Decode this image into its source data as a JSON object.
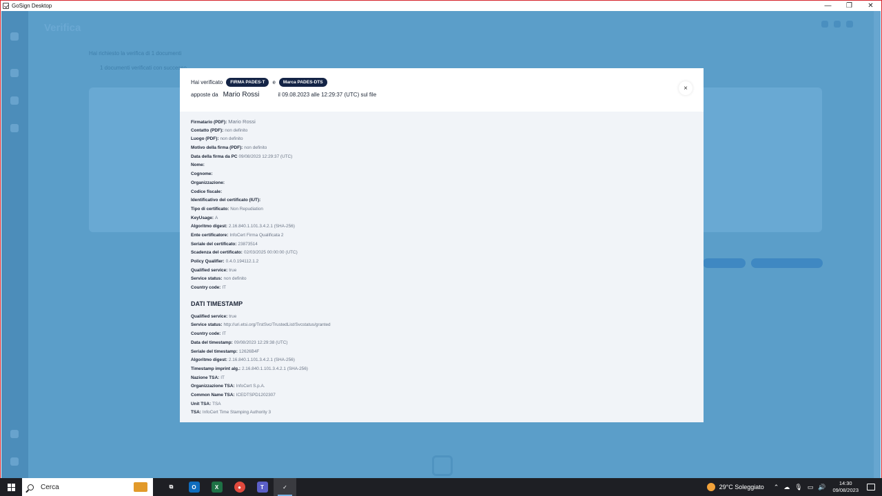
{
  "window": {
    "title": "GoSign Desktop",
    "controls": [
      "—",
      "❐",
      "✕"
    ]
  },
  "background_app": {
    "page_title": "Verifica",
    "line1": "Hai richiesto la verifica di 1 documenti",
    "line2": "1 documenti verificati con successo"
  },
  "modal": {
    "verified_prefix": "Hai verificato",
    "badge_signature": "FIRMA PADES-T",
    "conjunction": "e",
    "badge_timestamp": "Marca PADES-DTS",
    "applied_by": "apposte da",
    "signer_name": "Mario Rossi",
    "when": "il 09.08.2023 alle 12:29:37 (UTC) sul file",
    "close_symbol": "×",
    "signature_fields": [
      {
        "key": "Firmatario (PDF):",
        "value": "Mario Rossi"
      },
      {
        "key": "Contatto (PDF):",
        "value": "non definito"
      },
      {
        "key": "Luogo (PDF):",
        "value": "non definito"
      },
      {
        "key": "Motivo della firma (PDF):",
        "value": "non definito"
      },
      {
        "key": "Data della firma da PC",
        "value": "09/08/2023 12:29:37 (UTC)"
      },
      {
        "key": "Nome:",
        "value": ""
      },
      {
        "key": "Cognome:",
        "value": ""
      },
      {
        "key": "Organizzazione:",
        "value": ""
      },
      {
        "key": "Codice fiscale:",
        "value": ""
      },
      {
        "key": "Identificativo del certificato (IUT):",
        "value": ""
      },
      {
        "key": "Tipo di certificato:",
        "value": "Non Repudiation"
      },
      {
        "key": "KeyUsage:",
        "value": "A"
      },
      {
        "key": "Algoritmo digest:",
        "value": "2.16.840.1.101.3.4.2.1 (SHA-256)"
      },
      {
        "key": "Ente certificatore:",
        "value": "InfoCert Firma Qualificata 2"
      },
      {
        "key": "Seriale del certificato:",
        "value": "23873514"
      },
      {
        "key": "Scadenza del certificato:",
        "value": "02/03/2025 00:00:00 (UTC)"
      },
      {
        "key": "Policy Qualifier:",
        "value": "0.4.0.194112.1.2"
      },
      {
        "key": "Qualified service:",
        "value": "true"
      },
      {
        "key": "Service status:",
        "value": "non definito"
      },
      {
        "key": "Country code:",
        "value": "IT"
      }
    ],
    "timestamp_section_title": "DATI TIMESTAMP",
    "timestamp_fields": [
      {
        "key": "Qualified service:",
        "value": "true"
      },
      {
        "key": "Service status:",
        "value": "http://uri.etsi.org/TrstSvc/TrustedList/Svcstatus/granted"
      },
      {
        "key": "Country code:",
        "value": "IT"
      },
      {
        "key": "Data del timestamp:",
        "value": "09/08/2023 12:29:38 (UTC)"
      },
      {
        "key": "Seriale del timestamp:",
        "value": "12626B4F"
      },
      {
        "key": "Algoritmo digest:",
        "value": "2.16.840.1.101.3.4.2.1 (SHA-256)"
      },
      {
        "key": "Timestamp imprint alg.:",
        "value": "2.16.840.1.101.3.4.2.1 (SHA-256)"
      },
      {
        "key": "Nazione TSA:",
        "value": "IT"
      },
      {
        "key": "Organizzazione TSA:",
        "value": "InfoCert S.p.A."
      },
      {
        "key": "Common Name TSA:",
        "value": "ICEDTSPD1202307"
      },
      {
        "key": "Unit TSA:",
        "value": "TSA"
      },
      {
        "key": "TSA:",
        "value": "InfoCert Time Stamping Authority 3"
      }
    ]
  },
  "taskbar": {
    "search_placeholder": "Cerca",
    "weather": "29°C  Soleggiato",
    "time": "14:30",
    "date": "09/08/2023",
    "pinned": [
      {
        "name": "task-view-icon",
        "glyph": "⧉",
        "color": "#1e1f24"
      },
      {
        "name": "outlook-icon",
        "glyph": "O",
        "color": "#0f6cbd"
      },
      {
        "name": "excel-icon",
        "glyph": "X",
        "color": "#1e7145"
      },
      {
        "name": "chrome-icon",
        "glyph": "●",
        "color": "#e0493d"
      },
      {
        "name": "teams-icon",
        "glyph": "T",
        "color": "#5b5fc7"
      },
      {
        "name": "gosign-icon",
        "glyph": "✓",
        "color": "#3a3b40"
      }
    ]
  }
}
